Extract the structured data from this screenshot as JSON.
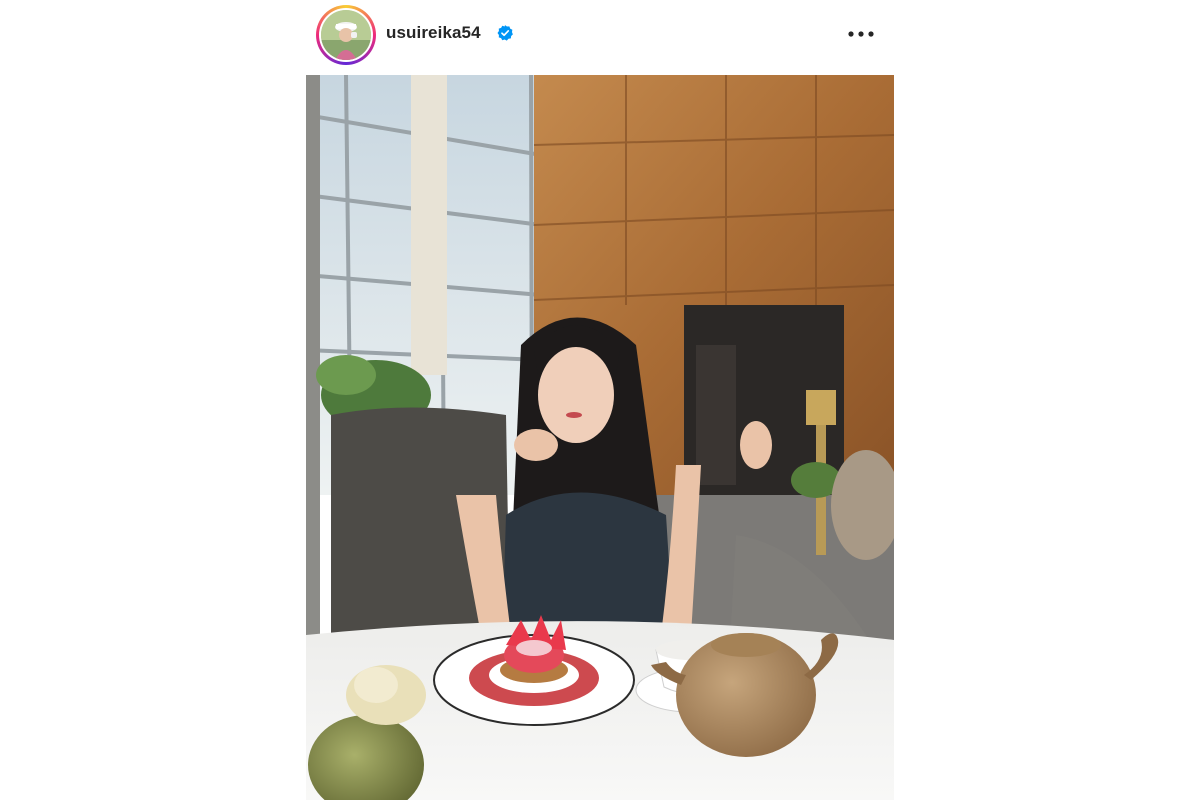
{
  "post": {
    "username": "usuireika54",
    "verified": true,
    "icons": {
      "avatar": "profile-avatar",
      "verified": "verified-badge-icon",
      "more": "more-options-icon"
    },
    "colors": {
      "verified_blue": "#0095f6",
      "text": "#262626",
      "ring_start": "#f9ce34",
      "ring_mid": "#ee2a7b",
      "ring_end": "#6228d7"
    }
  }
}
